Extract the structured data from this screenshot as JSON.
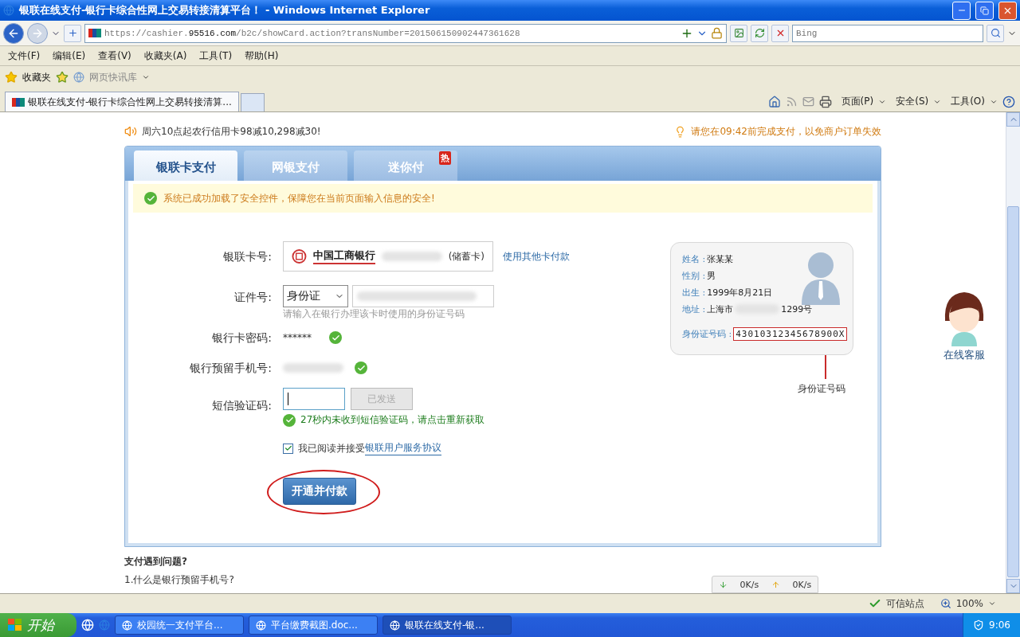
{
  "window": {
    "title": "银联在线支付-银行卡综合性网上交易转接清算平台！ - Windows Internet Explorer"
  },
  "address_bar": {
    "url_parts": [
      {
        "text": "https://cashier.",
        "strong": false
      },
      {
        "text": "95516.com",
        "strong": true
      },
      {
        "text": "/b2c/showCard.action?transNumber=201506150902447361628",
        "strong": false
      }
    ],
    "search_placeholder": "Bing"
  },
  "menu": [
    "文件(F)",
    "编辑(E)",
    "查看(V)",
    "收藏夹(A)",
    "工具(T)",
    "帮助(H)"
  ],
  "favorites_bar": {
    "favorites": "收藏夹",
    "web_slice": "网页快讯库"
  },
  "tabs": [
    {
      "label": "银联在线支付-银行卡综合性网上交易转接清算...",
      "selected": true
    }
  ],
  "command_bar": [
    "页面(P)",
    "安全(S)",
    "工具(O)"
  ],
  "page": {
    "promo": "周六10点起农行信用卡98减10,298减30!",
    "deadline": "请您在09:42前完成支付，以免商户订单失效",
    "payment_tabs": [
      {
        "label": "银联卡支付",
        "selected": true
      },
      {
        "label": "网银支付",
        "selected": false
      },
      {
        "label": "迷你付",
        "selected": false,
        "badge": "热"
      }
    ],
    "security_notice": "系统已成功加载了安全控件，保障您在当前页面输入信息的安全!",
    "form": {
      "card": {
        "label": "银联卡号:",
        "bank_name": "中国工商银行",
        "card_type": "(储蓄卡)",
        "other_card_link": "使用其他卡付款"
      },
      "id": {
        "label": "证件号:",
        "id_type": "身份证",
        "hint": "请输入在银行办理该卡时使用的身份证号码"
      },
      "password": {
        "label": "银行卡密码:",
        "value": "******",
        "verified": true
      },
      "phone": {
        "label": "银行预留手机号:",
        "verified": true
      },
      "sms": {
        "label": "短信验证码:",
        "send_button": "已发送",
        "send_disabled": true,
        "message": "27秒内未收到短信验证码，请点击重新获取"
      },
      "agreement": {
        "checked": true,
        "text": "我已阅读并接受",
        "link": "银联用户服务协议"
      },
      "submit": "开通并付款"
    },
    "id_card": {
      "rows": [
        {
          "label": "姓名 :",
          "value": "张某某"
        },
        {
          "label": "性别 :",
          "value": "男"
        },
        {
          "label": "出生 :",
          "value": "1999年8月21日"
        },
        {
          "label": "地址 :",
          "value": "上海市",
          "value_end": "1299号"
        }
      ],
      "number_label": "身份证号码 :",
      "number": "43010312345678900X",
      "caption": "身份证号码"
    },
    "help_title": "支付遇到问题?",
    "help_item": "1.什么是银行预留手机号?",
    "service": "在线客服",
    "speed": {
      "down": "0K/s",
      "up": "0K/s"
    }
  },
  "status_bar": {
    "zone": "可信站点",
    "zoom": "100%"
  },
  "taskbar": {
    "start": "开始",
    "tasks": [
      {
        "label": "校园统一支付平台...",
        "selected": false
      },
      {
        "label": "平台缴费截图.doc...",
        "selected": false
      },
      {
        "label": "银联在线支付-银...",
        "selected": true
      }
    ],
    "clock": "9:06"
  }
}
